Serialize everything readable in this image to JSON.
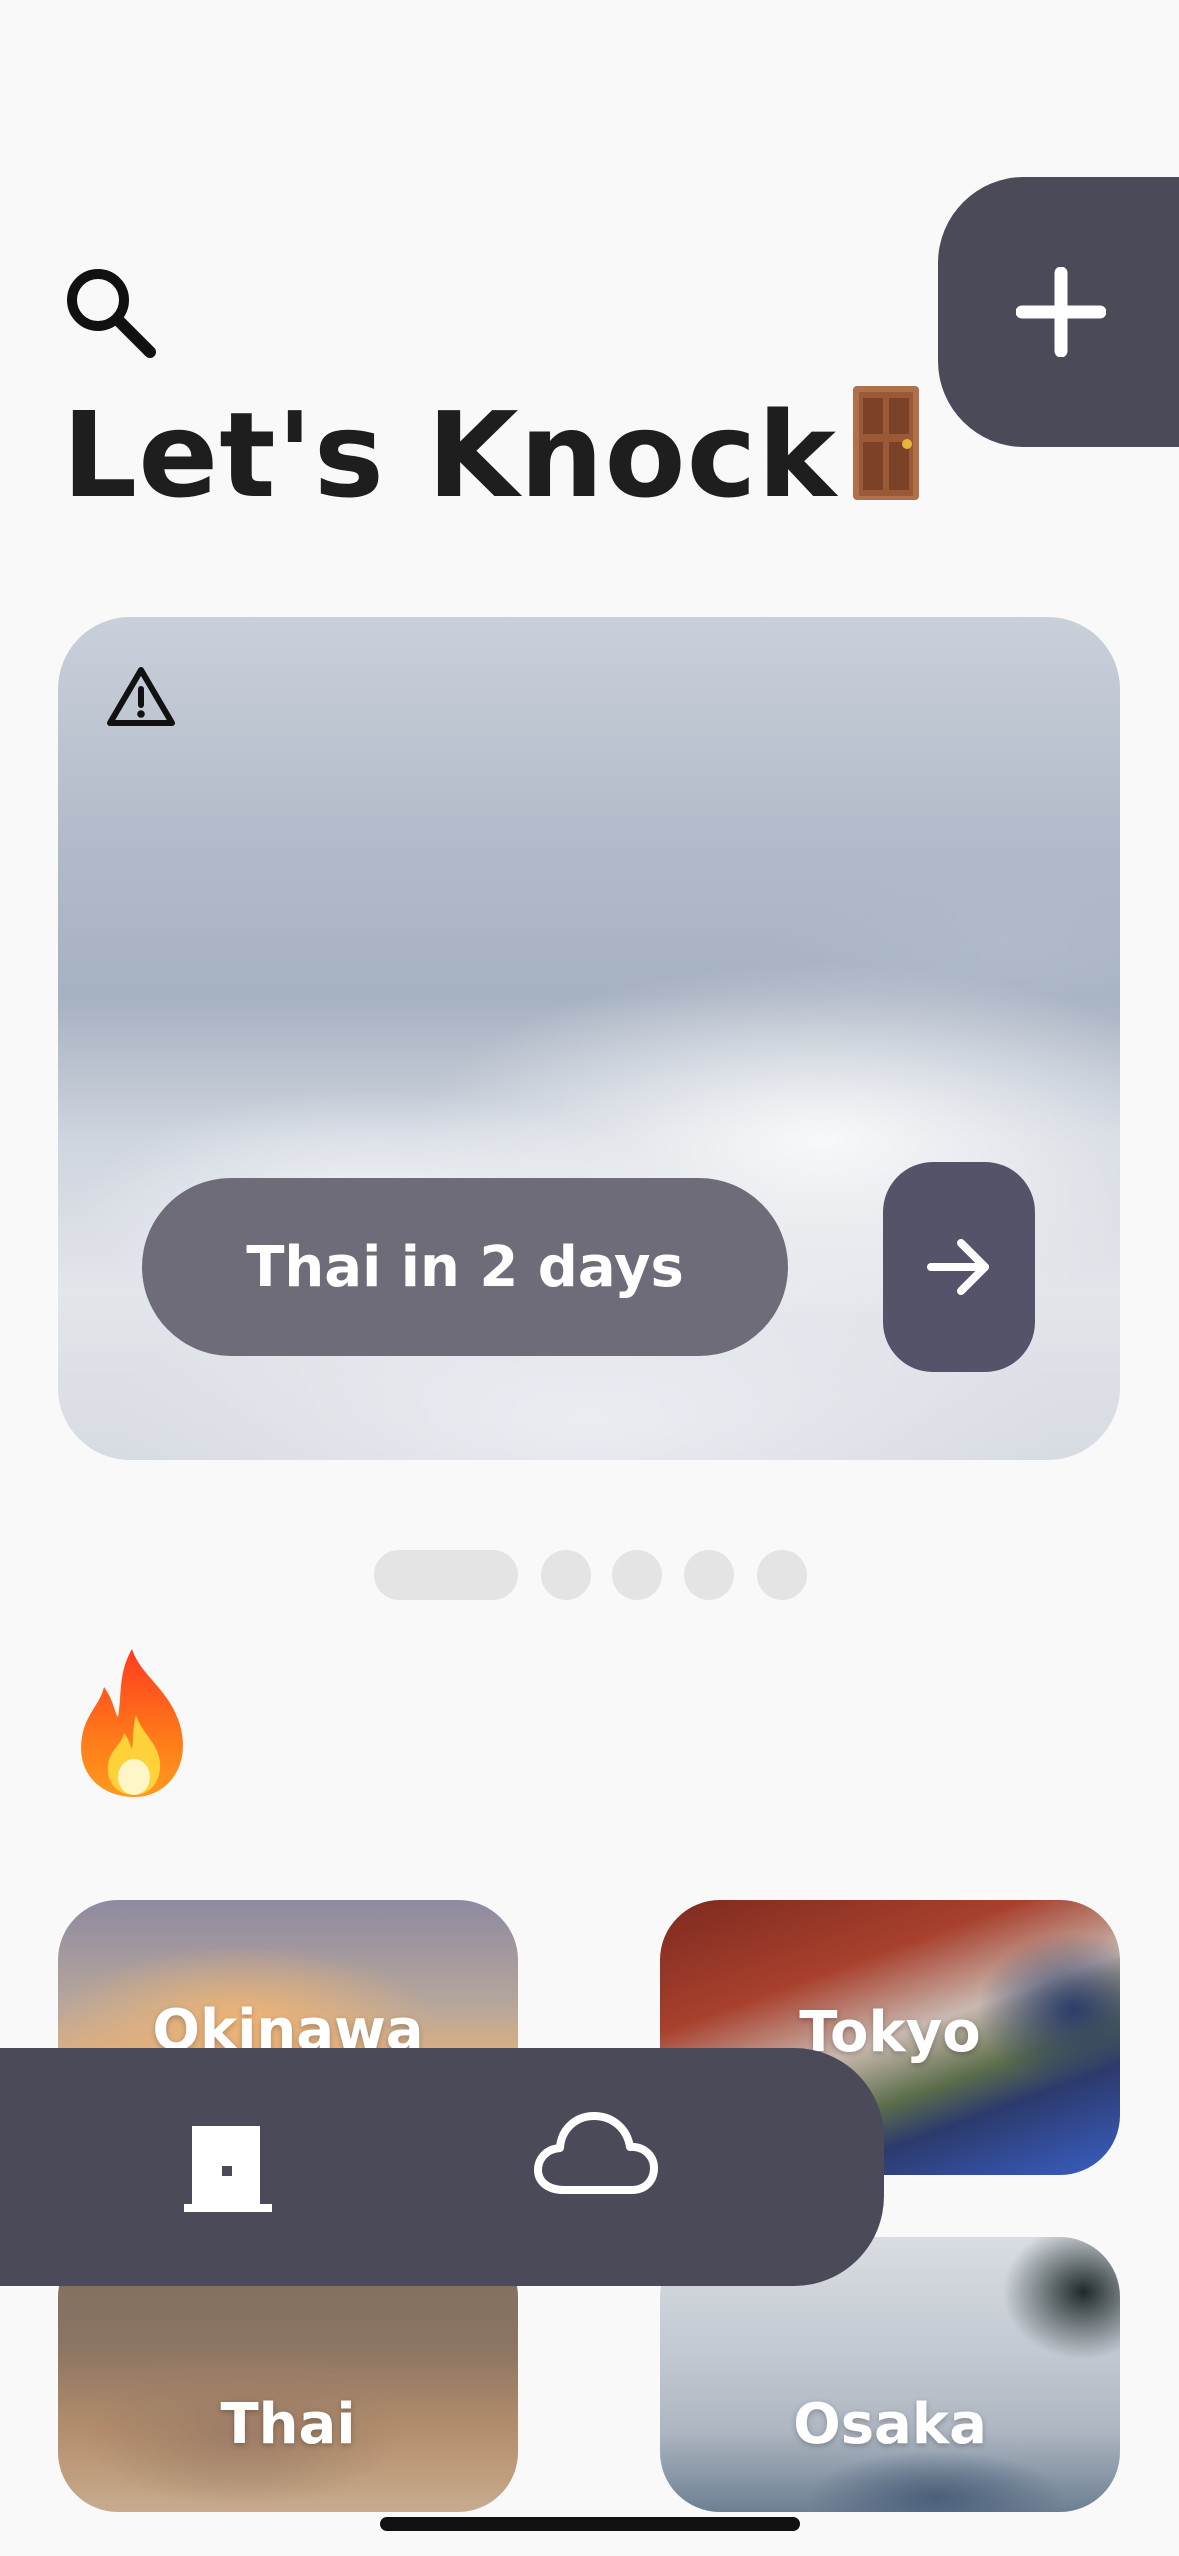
{
  "header": {
    "title": "Let's Knock",
    "search_icon": "search-icon",
    "title_emoji": "door"
  },
  "add_button": {
    "icon": "plus-icon"
  },
  "hero": {
    "alert_icon": "warning-icon",
    "trip_label": "Thai in 2 days",
    "go_icon": "arrow-right-icon"
  },
  "carousel": {
    "count": 5,
    "active_index": 0
  },
  "trending": {
    "icon": "fire-icon"
  },
  "cities": [
    {
      "name": "Okinawa"
    },
    {
      "name": "Tokyo"
    },
    {
      "name": "Thai"
    },
    {
      "name": "Osaka"
    }
  ],
  "bottom_nav": {
    "items": [
      {
        "icon": "door-icon"
      },
      {
        "icon": "cloud-icon"
      }
    ]
  },
  "colors": {
    "accent_dark": "#4b4a58",
    "pill": "#6f6c7a",
    "background": "#f9f9f9"
  }
}
